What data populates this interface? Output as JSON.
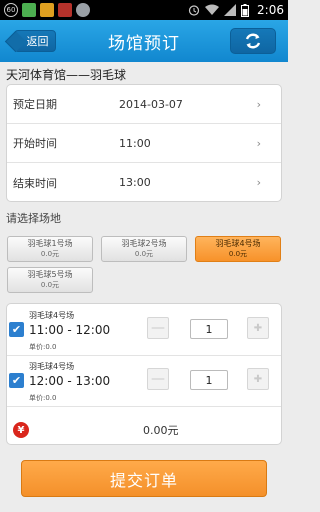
{
  "status_bar": {
    "badge": "60",
    "time": "2:06",
    "icons": [
      "notification-badge-icon",
      "app-icon-1",
      "app-icon-2",
      "app-icon-3",
      "app-icon-4",
      "alarm-icon",
      "wifi-icon",
      "signal-icon",
      "battery-icon"
    ]
  },
  "header": {
    "back_label": "返回",
    "title": "场馆预订",
    "refresh_icon": "refresh-icon"
  },
  "venue": {
    "name": "天河体育馆——羽毛球"
  },
  "date_form": {
    "rows": [
      {
        "label": "预定日期",
        "value": "2014-03-07"
      },
      {
        "label": "开始时间",
        "value": "11:00"
      },
      {
        "label": "结束时间",
        "value": "13:00"
      }
    ]
  },
  "court_section_label": "请选择场地",
  "courts": [
    {
      "name": "羽毛球1号场",
      "price": "0.0元",
      "selected": false
    },
    {
      "name": "羽毛球2号场",
      "price": "0.0元",
      "selected": false
    },
    {
      "name": "羽毛球4号场",
      "price": "0.0元",
      "selected": true
    },
    {
      "name": "羽毛球5号场",
      "price": "0.0元",
      "selected": false
    }
  ],
  "bookings": [
    {
      "court": "羽毛球4号场",
      "time": "11:00 - 12:00",
      "price": "单价:0.0",
      "quantity": "1",
      "checked": true
    },
    {
      "court": "羽毛球4号场",
      "time": "12:00 - 13:00",
      "price": "单价:0.0",
      "quantity": "1",
      "checked": true
    }
  ],
  "total": {
    "icon": "yen-icon",
    "value": "0.00元"
  },
  "submit_label": "提交订单",
  "colors": {
    "header": "#1a96dc",
    "accent_orange": "#f7922a",
    "checkbox_blue": "#2c7fcf",
    "yen_red": "#d9261c"
  }
}
